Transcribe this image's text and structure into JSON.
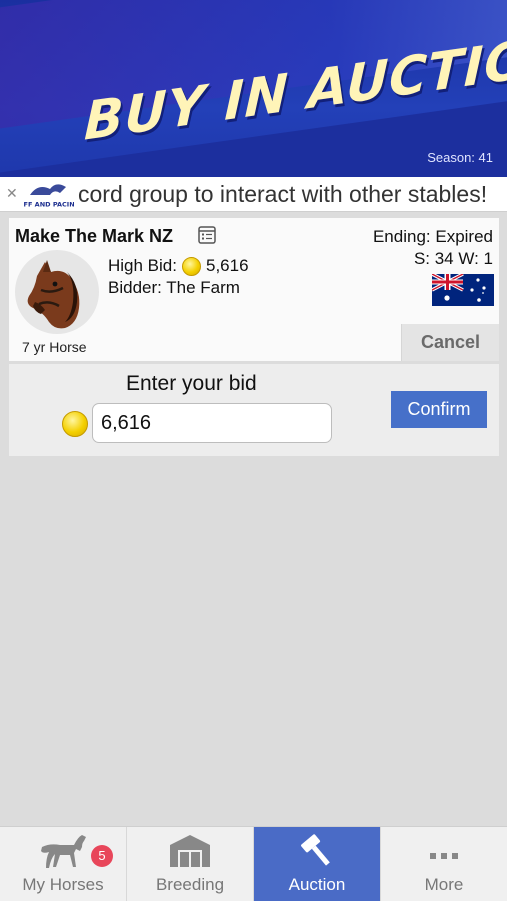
{
  "banner": {
    "title": "BUY IN AUCTION",
    "season": "Season: 41"
  },
  "marquee": {
    "text": "cord group to interact with other stables!",
    "logo_icon": "off-and-pacing-logo",
    "close_icon": "close-icon"
  },
  "horse": {
    "name": "Make The Mark NZ",
    "high_bid_label": "High Bid:",
    "high_bid_value": "5,616",
    "bidder": "Bidder: The Farm",
    "ending": "Ending: Expired",
    "stats": "S: 34 W: 1",
    "age": "7 yr Horse",
    "country_flag": "australia-flag"
  },
  "actions": {
    "cancel": "Cancel",
    "confirm": "Confirm"
  },
  "bid": {
    "label": "Enter your bid",
    "value": "6,616"
  },
  "tabs": [
    {
      "label": "My Horses",
      "badge": "5",
      "icon": "horse-icon"
    },
    {
      "label": "Breeding",
      "icon": "barn-icon"
    },
    {
      "label": "Auction",
      "icon": "gavel-icon",
      "active": true
    },
    {
      "label": "More",
      "icon": "more-dots-icon"
    }
  ],
  "colors": {
    "accent": "#4a6bc6",
    "badge": "#e8465a",
    "coin": "#f4d000"
  }
}
